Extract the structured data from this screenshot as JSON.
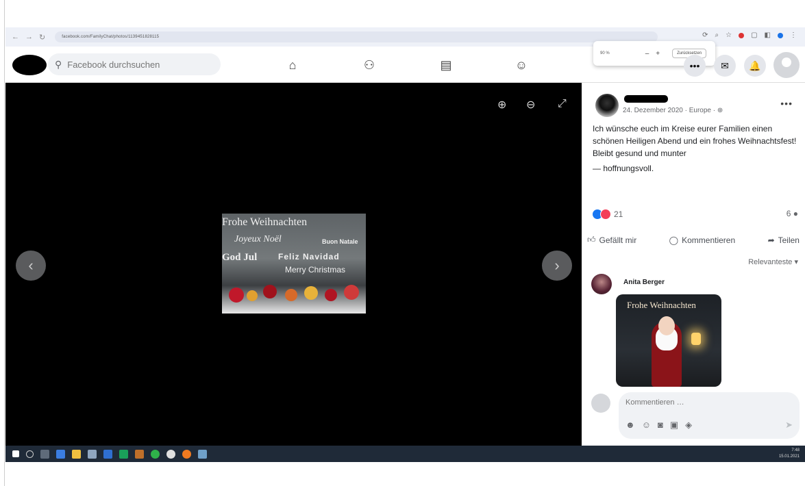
{
  "browser": {
    "url": "facebook.com/FamilyChat/photos/1139451828115",
    "zoom_percent": "90 %",
    "zoom_reset_label": "Zurücksetzen"
  },
  "header": {
    "search_placeholder": "Facebook durchsuchen"
  },
  "photo": {
    "lines": [
      "Frohe Weihnachten",
      "Joyeux Noël",
      "Buon Natale",
      "God Jul",
      "Feliz Navidad",
      "Merry Christmas"
    ]
  },
  "post": {
    "date": "24. Dezember 2020 · Europe · ",
    "text_lines": [
      "Ich wünsche euch im Kreise eurer Familien einen schönen Heiligen Abend und ein frohes Weihnachtsfest!",
      "Bleibt gesund und munter",
      "— hoffnungsvoll."
    ],
    "reaction_count": "21",
    "comment_count": "6",
    "actions": {
      "like": "Gefällt mir",
      "comment": "Kommentieren",
      "share": "Teilen"
    },
    "sort_label": "Relevanteste"
  },
  "comment": {
    "author": "Anita Berger",
    "sticker_text": "Frohe Weihnachten"
  },
  "composer": {
    "placeholder": "Kommentieren …"
  },
  "taskbar": {
    "time": "7:48",
    "date": "15.01.2021"
  },
  "colors": {
    "facebook_blue": "#1877f2",
    "viewer_bg": "#000000",
    "taskbar_bg": "#1f2a38"
  }
}
